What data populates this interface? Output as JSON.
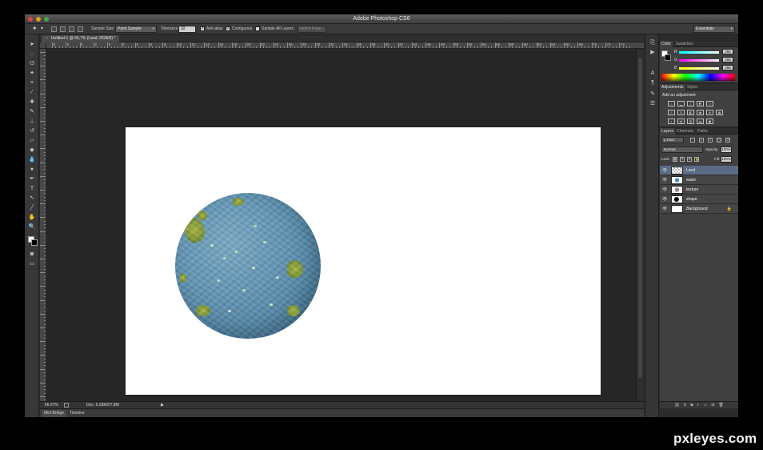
{
  "window": {
    "title": "Adobe Photoshop CS6"
  },
  "options_bar": {
    "sample_size_label": "Sample Size:",
    "sample_size_value": "Point Sample",
    "tolerance_label": "Tolerance:",
    "tolerance_value": "32",
    "anti_alias_label": "Anti-alias",
    "contiguous_label": "Contiguous",
    "sample_all_layers_label": "Sample All Layers",
    "refine_edge_label": "Refine Edge...",
    "workspace_value": "Essentials"
  },
  "document_tab": {
    "title": "Untitled-1 @ 66,7% (Land, RGB/8) *"
  },
  "ruler_labels": [
    "8",
    "6",
    "4",
    "2",
    "0",
    "2",
    "4",
    "6",
    "8",
    "10",
    "12",
    "14",
    "16",
    "18",
    "20",
    "22",
    "24",
    "26",
    "28",
    "30",
    "32",
    "34",
    "36",
    "38",
    "40",
    "42",
    "44",
    "46",
    "48",
    "50",
    "52",
    "54",
    "56",
    "58",
    "60",
    "62",
    "64",
    "66",
    "68",
    "70",
    "72",
    "74"
  ],
  "status_bar": {
    "zoom": "66.67%",
    "doc_size": "Doc: 5,93M/27,8M"
  },
  "bottom_tabs": [
    "Mini Bridge",
    "Timeline"
  ],
  "color_panel": {
    "tabs": [
      "Color",
      "Swatches"
    ],
    "sliders": [
      {
        "label": "R",
        "value": "255"
      },
      {
        "label": "G",
        "value": "255"
      },
      {
        "label": "B",
        "value": "255"
      }
    ]
  },
  "adjustments_panel": {
    "tabs": [
      "Adjustments",
      "Styles"
    ],
    "title": "Add an adjustment"
  },
  "layers_panel": {
    "tabs": [
      "Layers",
      "Channels",
      "Paths"
    ],
    "kind_filter": "Kind",
    "blend_mode": "Normal",
    "opacity_label": "Opacity:",
    "opacity_value": "100%",
    "lock_label": "Lock:",
    "fill_label": "Fill:",
    "fill_value": "100%",
    "layers": [
      {
        "name": "Land",
        "selected": true
      },
      {
        "name": "water",
        "selected": false
      },
      {
        "name": "texture",
        "selected": false
      },
      {
        "name": "shape",
        "selected": false
      },
      {
        "name": "Background",
        "selected": false,
        "locked": true
      }
    ]
  },
  "colors": {
    "selection": "#5a6b86",
    "panel_bg": "#404040",
    "app_bg": "#2b2b2b",
    "canvas_bg": "#ffffff"
  },
  "watermark": "pxleyes.com"
}
